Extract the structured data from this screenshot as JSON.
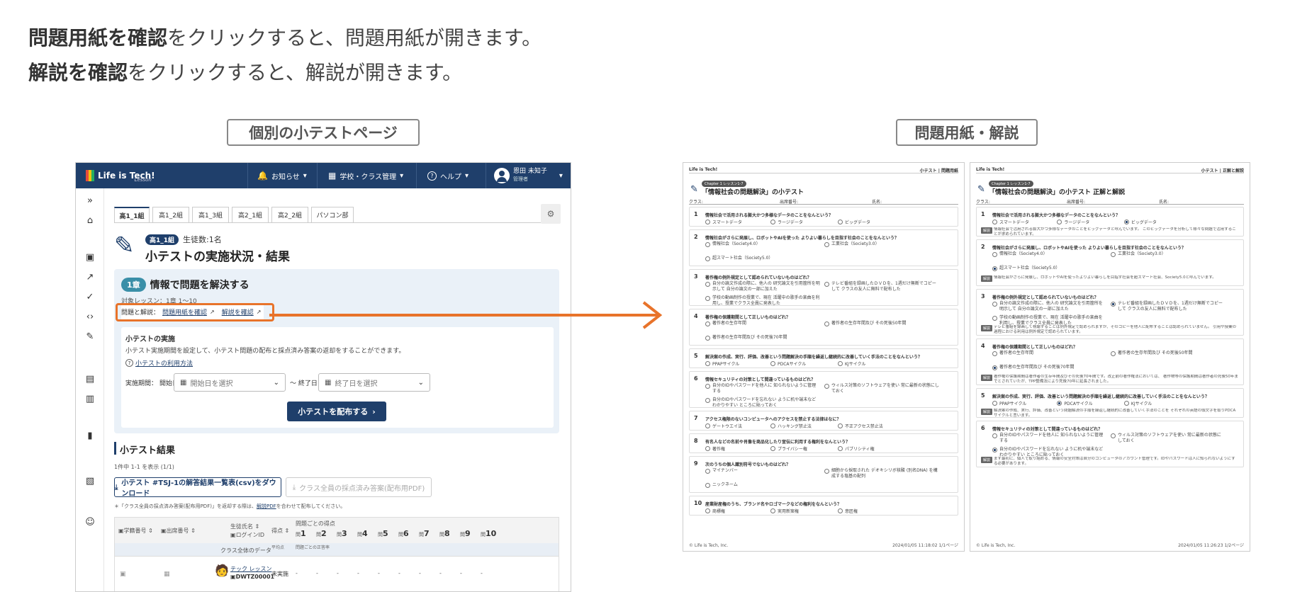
{
  "intro": {
    "line1_bold": "問題用紙を確認",
    "line1_rest": "をクリックすると、問題用紙が開きます。",
    "line2_bold": "解説を確認",
    "line2_rest": "をクリックすると、解説が開きます。"
  },
  "captions": {
    "left": "個別の小テストページ",
    "right": "問題用紙・解説"
  },
  "app": {
    "logo": "Life is Tech!",
    "logo_sub": "Lesson",
    "nav": {
      "notice": "お知らせ",
      "school": "学校・クラス管理",
      "help": "ヘルプ",
      "user_name": "恩田 未知子",
      "user_role": "管理者"
    },
    "tabs": [
      "高1_1組",
      "高1_2組",
      "高1_3組",
      "高2_1組",
      "高2_2組",
      "パソコン部"
    ],
    "class_badge": "高1_1組",
    "students": "生徒数:1名",
    "page_title": "小テストの実施状況・結果",
    "chapter_badge": "1章",
    "chapter_title": "情報で問題を解決する",
    "target": "対象レッスン：1章 1～10",
    "qa_label": "問題と解説：",
    "qa_problem": "問題用紙を確認",
    "qa_answer": "解説を確認",
    "exec_title": "小テストの実施",
    "exec_desc": "小テスト実施期間を設定して、小テスト問題の配布と採点済み答案の返却をすることができます。",
    "usage_link": "小テストの利用方法",
    "period_label": "実施期間：",
    "start_label": "開始日",
    "start_ph": "開始日を選択",
    "end_label": "〜 終了日",
    "end_ph": "終了日を選択",
    "distribute": "小テストを配布する",
    "results_title": "小テスト結果",
    "results_count": "1件中 1-1 を表示 (1/1)",
    "download_csv": "小テスト #TSJ-1の解答結果一覧表(csv)をダウンロード",
    "download_pdf": "クラス全員の採点済み答案(配布用PDF)",
    "note_pre": "「クラス全員の採点済み答案(配布用PDF)」を返却する際は、",
    "note_link": "解説PDF",
    "note_post": "を合わせて配布してください。",
    "cols": {
      "student_no": "学籍番号",
      "attend_no": "出席番号",
      "student_name": "生徒氏名",
      "login": "ログインID",
      "score": "得点",
      "per_q": "問題ごとの得点",
      "class_data": "クラス全体のデータ",
      "avg": "平均点",
      "rate": "問題ごとの正答率"
    },
    "qcols": [
      "問1",
      "問2",
      "問3",
      "問4",
      "問5",
      "問6",
      "問7",
      "問8",
      "問9",
      "問10"
    ],
    "row": {
      "name": "テック レッスン",
      "login": "DWTZ00001",
      "status": "未実施",
      "dash": "-"
    }
  },
  "paper_q": {
    "brand": "Life is Tech!",
    "header_right": "小テスト | 問題用紙",
    "chapter_tag": "Chapter 1 レッスン1-7",
    "title": "「情報社会の問題解決」の小テスト",
    "class": "クラス:",
    "attend": "出席番号:",
    "name": "氏名:",
    "footer_left": "© Life is Tech, Inc.",
    "footer_right": "2024/01/05 11:18:02 1/1ページ",
    "questions": [
      {
        "n": "1",
        "q": "情報社会で活用される膨大かつ多様なデータのことをなんという？",
        "o": [
          "スマートデータ",
          "ラージデータ",
          "ビッグデータ"
        ]
      },
      {
        "n": "2",
        "q": "情報社会がさらに発展し、ロボットやAIを使った よりよい暮らしを目指す社会のことをなんという？",
        "o": [
          "情報社会（Society4.0）",
          "工業社会（Society3.0）",
          "超スマート社会（Society5.0）"
        ]
      },
      {
        "n": "3",
        "q": "著作権の例外規定として認められていないものはどれ？",
        "o": [
          "自分の論文作成の際に、他人の 研究論文を引用箇所を明示して 自分の論文の一部に加えた",
          "テレビ番組を録画したＤＶＤを、1週だけ無断でコピーして クラスの友人に無料で配布した",
          "学校の動画制作の授業で、現在 活躍中の歌手の楽曲を利用し、授業でクラス全員に発表した"
        ]
      },
      {
        "n": "4",
        "q": "著作権の保護期間として正しいものはどれ？",
        "o": [
          "著作者の生存年間",
          "著作者の生存年間及び その死後50年間",
          "著作者の生存年間及び その死後70年間"
        ]
      },
      {
        "n": "5",
        "q": "解決案の作成、実行、評価、改善という問題解決の手順を繰返し継続的に改善していく手法のことをなんという？",
        "o": [
          "PPAPサイクル",
          "PDCAサイクル",
          "KJサイクル"
        ]
      },
      {
        "n": "6",
        "q": "情報セキュリティの対策として間違っているものはどれ？",
        "o": [
          "自分のIDやパスワードを他人に 知られないように管理する",
          "ウィルス対策のソフトウェアを使い 常に最新の状態にしておく",
          "自分のIDやパスワードを忘れない ように机や端末などわかりやすい ところに貼っておく"
        ]
      },
      {
        "n": "7",
        "q": "アクセス権限のないコンピュータへのアクセスを禁止する法律はなに？",
        "o": [
          "ゲートウエイ法",
          "ハッキング禁止法",
          "不正アクセス禁止法"
        ]
      },
      {
        "n": "8",
        "q": "有名人などの名前や肖像を商品化したり宣伝に利用する権利をなんという？",
        "o": [
          "著作権",
          "プライバシー権",
          "パブリシティ権"
        ]
      },
      {
        "n": "9",
        "q": "次のうちの個人識別符号でないものはどれ？",
        "o": [
          "マイナンバー",
          "細胞から採取された デオキシリボ核酸 (別名DNA) を構成する塩基の配列",
          "ニックネーム"
        ]
      },
      {
        "n": "10",
        "q": "産業財産権のうち、ブランド名やロゴマークなどの権利をなんという？",
        "o": [
          "商標権",
          "実用新案権",
          "意匠権"
        ]
      }
    ]
  },
  "paper_a": {
    "brand": "Life is Tech!",
    "header_right": "小テスト | 正解と解説",
    "chapter_tag": "Chapter 1 レッスン1-7",
    "title": "「情報社会の問題解決」の小テスト 正解と解説",
    "class": "クラス:",
    "attend": "出席番号:",
    "name": "氏名:",
    "exp_badge": "解説",
    "footer_left": "© Life is Tech, Inc.",
    "footer_right": "2024/01/05 11:26:23 1/2ページ",
    "questions": [
      {
        "n": "1",
        "q": "情報社会で活用される膨大かつ多様なデータのことをなんという？",
        "o": [
          "スマートデータ",
          "ラージデータ",
          "ビッグデータ"
        ],
        "a": 2,
        "e": [
          "情報社会で活用される膨大かつ多様なデータのことをビッグデータと呼んでいます。 このビッグデータを分析して様々な問題で活用することが求められています。"
        ]
      },
      {
        "n": "2",
        "q": "情報社会がさらに発展し、ロボットやAIを使った よりよい暮らしを目指す社会のことをなんという？",
        "o": [
          "情報社会（Society4.0）",
          "工業社会（Society3.0）",
          "超スマート社会（Society5.0）"
        ],
        "a": 2,
        "e": [
          "情報社会がさらに発展し、ロボットやAIを使ったよりよい暮らしを目指す社会を超スマート社会、Society5.0と呼んでいます。"
        ]
      },
      {
        "n": "3",
        "q": "著作権の例外規定として認められていないものはどれ？",
        "o": [
          "自分の論文作成の際に、他人の 研究論文を引用箇所を明示して 自分の論文の一部に加えた",
          "テレビ番組を録画したＤＶＤを、1週だけ無断でコピーして クラスの友人に無料で配布した",
          "学校の動画制作の授業で、現在 活躍中の歌手の楽曲を利用し、授業でクラス全員に発表した"
        ],
        "a": 1,
        "e": [
          "テレビ番組を録画して視聴することは例外規定で認められますが、そのコピーを他人に配布することは認められていません。 引用や授業の過程における利用は例外規定で認められています。"
        ]
      },
      {
        "n": "4",
        "q": "著作権の保護期間として正しいものはどれ？",
        "o": [
          "著作者の生存年間",
          "著作者の生存年間及び その死後50年間",
          "著作者の生存年間及び その死後70年間"
        ],
        "a": 2,
        "e": [
          "著作権の保護期間は著作者の生存年間及びその死後70年間です。改正前の著作権法においては、 著作物等の保護期間は著作者の死後50年までとされていたが、TPP整備法により死後70年に延長されました。"
        ]
      },
      {
        "n": "5",
        "q": "解決案の作成、実行、評価、改善という問題解決の手順を繰返し継続的に改善していく手法のことをなんという？",
        "o": [
          "PPAPサイクル",
          "PDCAサイクル",
          "KJサイクル"
        ],
        "a": 1,
        "e": [
          "解決案の作成、実行、評価、改善という問題解決の手順を繰返し継続的に改善していく手法のことを それぞれの英語の頭文字を取りPDCA サイクルと言います。"
        ]
      },
      {
        "n": "6",
        "q": "情報セキュリティの対策として間違っているものはどれ？",
        "o": [
          "自分のIDやパスワードを他人に 知られないように管理する",
          "ウィルス対策のソフトウェアを使い 常に最新の状態にしておく",
          "自分のIDやパスワードを忘れない ように机や端末などわかりやすい ところに貼っておく"
        ],
        "a": 2,
        "e": [
          "まず最初に、個人で取り組める、情報の安全対策は自分のコンピュータのアカウント管理です。IDやパスワードは人に知られないようにする必要があります。"
        ]
      }
    ]
  }
}
